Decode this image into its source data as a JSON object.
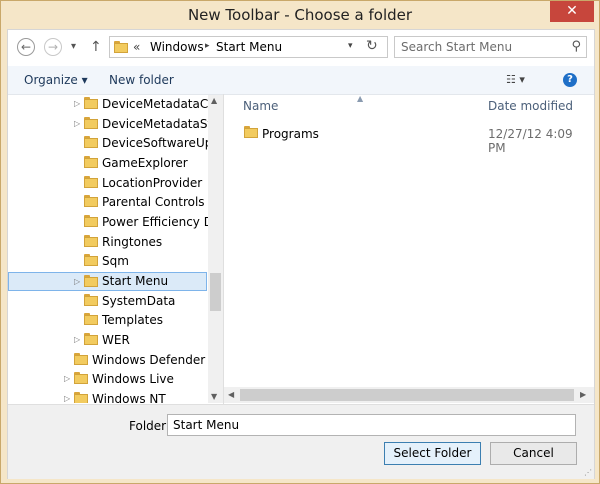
{
  "window": {
    "title": "New Toolbar - Choose a folder",
    "close_glyph": "✕"
  },
  "nav": {
    "back_glyph": "←",
    "forward_glyph": "→",
    "recent_glyph": "▾",
    "up_glyph": "↑",
    "overflow_glyph": "«",
    "crumbs": [
      "Windows",
      "Start Menu"
    ],
    "crumb_sep": "▸",
    "dropdown_glyph": "▾",
    "refresh_glyph": "↻",
    "search_placeholder": "Search Start Menu",
    "search_glyph": "⚲"
  },
  "toolbar": {
    "organize_label": "Organize ▾",
    "new_folder_label": "New folder",
    "view_glyph": "☷ ▾",
    "help_glyph": "?"
  },
  "tree": {
    "items": [
      {
        "label": "DeviceMetadataCach",
        "expandable": true
      },
      {
        "label": "DeviceMetadataStore",
        "expandable": true
      },
      {
        "label": "DeviceSoftwareUpdat",
        "expandable": false
      },
      {
        "label": "GameExplorer",
        "expandable": false
      },
      {
        "label": "LocationProvider",
        "expandable": false
      },
      {
        "label": "Parental Controls",
        "expandable": false
      },
      {
        "label": "Power Efficiency Diag",
        "expandable": false
      },
      {
        "label": "Ringtones",
        "expandable": false
      },
      {
        "label": "Sqm",
        "expandable": false
      },
      {
        "label": "Start Menu",
        "expandable": true,
        "selected": true
      },
      {
        "label": "SystemData",
        "expandable": false
      },
      {
        "label": "Templates",
        "expandable": false
      },
      {
        "label": "WER",
        "expandable": true
      },
      {
        "label": "Windows Defender",
        "expandable": false
      },
      {
        "label": "Windows Live",
        "expandable": true
      },
      {
        "label": "Windows NT",
        "expandable": true
      }
    ],
    "expand_glyph": "▷",
    "scroll_up_glyph": "▲",
    "scroll_down_glyph": "▼"
  },
  "files": {
    "col_name": "Name",
    "col_date": "Date modified",
    "sort_glyph": "▲",
    "rows": [
      {
        "name": "Programs",
        "date": "12/27/12 4:09 PM"
      }
    ],
    "scroll_left_glyph": "◀",
    "scroll_right_glyph": "▶"
  },
  "bottom": {
    "folder_label": "Folder:",
    "folder_value": "Start Menu",
    "select_label": "Select Folder",
    "cancel_label": "Cancel",
    "grip_glyph": "⋰"
  }
}
